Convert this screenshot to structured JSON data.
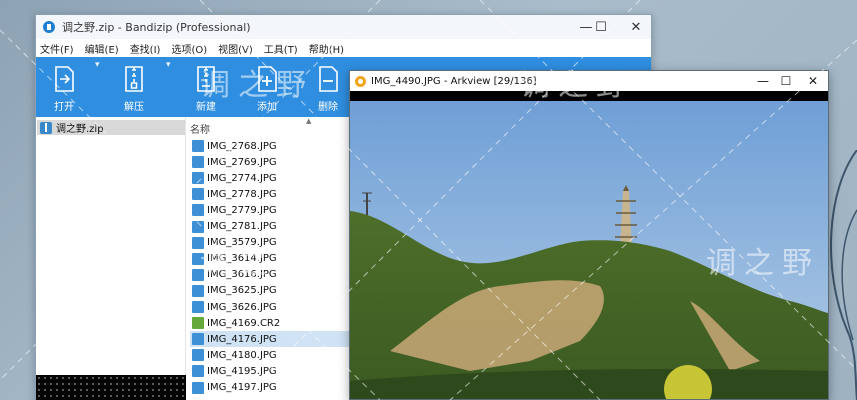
{
  "watermark": {
    "text": "调之野"
  },
  "bandizip": {
    "title": "调之野.zip - Bandizip (Professional)",
    "window_controls": {
      "minimize": "—",
      "maximize": "☐",
      "close": "✕"
    },
    "menu": [
      "文件(F)",
      "编辑(E)",
      "查找(I)",
      "选项(O)",
      "视图(V)",
      "工具(T)",
      "帮助(H)"
    ],
    "toolbar": {
      "open": "打开",
      "extract": "解压",
      "new": "新建",
      "add": "添加",
      "delete": "删除"
    },
    "tree": {
      "root": "调之野.zip"
    },
    "list": {
      "column_name": "名称",
      "files": [
        "IMG_2768.JPG",
        "IMG_2769.JPG",
        "IMG_2774.JPG",
        "IMG_2778.JPG",
        "IMG_2779.JPG",
        "IMG_2781.JPG",
        "IMG_3579.JPG",
        "IMG_3614.JPG",
        "IMG_3616.JPG",
        "IMG_3625.JPG",
        "IMG_3626.JPG",
        "IMG_4169.CR2",
        "IMG_4176.JPG",
        "IMG_4180.JPG",
        "IMG_4195.JPG",
        "IMG_4197.JPG"
      ],
      "selected_file": "IMG_4176.JPG"
    }
  },
  "arkview": {
    "title": "IMG_4490.JPG - Arkview [29/136]",
    "window_controls": {
      "minimize": "—",
      "maximize": "☐",
      "close": "✕"
    }
  },
  "colors": {
    "toolbar_blue": "#2f8ee0",
    "selected_row": "#cfe3f5",
    "jpg_icon": "#3d8fd6",
    "cr2_icon": "#66a83a"
  }
}
